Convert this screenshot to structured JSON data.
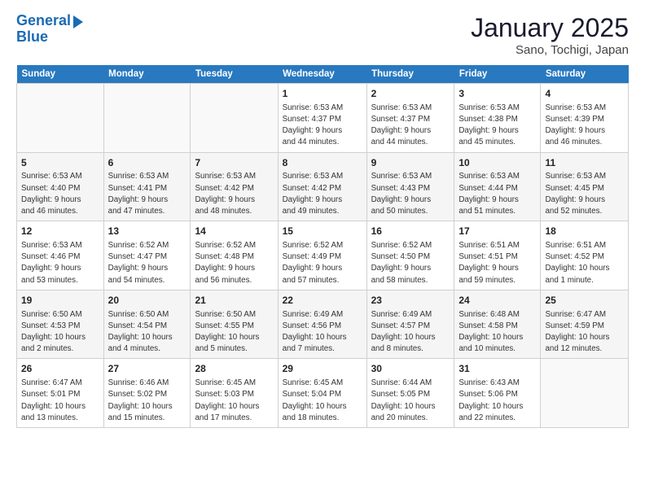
{
  "header": {
    "logo_line1": "General",
    "logo_line2": "Blue",
    "month": "January 2025",
    "location": "Sano, Tochigi, Japan"
  },
  "days_of_week": [
    "Sunday",
    "Monday",
    "Tuesday",
    "Wednesday",
    "Thursday",
    "Friday",
    "Saturday"
  ],
  "weeks": [
    {
      "days": [
        {
          "num": "",
          "info": ""
        },
        {
          "num": "",
          "info": ""
        },
        {
          "num": "",
          "info": ""
        },
        {
          "num": "1",
          "info": "Sunrise: 6:53 AM\nSunset: 4:37 PM\nDaylight: 9 hours\nand 44 minutes."
        },
        {
          "num": "2",
          "info": "Sunrise: 6:53 AM\nSunset: 4:37 PM\nDaylight: 9 hours\nand 44 minutes."
        },
        {
          "num": "3",
          "info": "Sunrise: 6:53 AM\nSunset: 4:38 PM\nDaylight: 9 hours\nand 45 minutes."
        },
        {
          "num": "4",
          "info": "Sunrise: 6:53 AM\nSunset: 4:39 PM\nDaylight: 9 hours\nand 46 minutes."
        }
      ]
    },
    {
      "days": [
        {
          "num": "5",
          "info": "Sunrise: 6:53 AM\nSunset: 4:40 PM\nDaylight: 9 hours\nand 46 minutes."
        },
        {
          "num": "6",
          "info": "Sunrise: 6:53 AM\nSunset: 4:41 PM\nDaylight: 9 hours\nand 47 minutes."
        },
        {
          "num": "7",
          "info": "Sunrise: 6:53 AM\nSunset: 4:42 PM\nDaylight: 9 hours\nand 48 minutes."
        },
        {
          "num": "8",
          "info": "Sunrise: 6:53 AM\nSunset: 4:42 PM\nDaylight: 9 hours\nand 49 minutes."
        },
        {
          "num": "9",
          "info": "Sunrise: 6:53 AM\nSunset: 4:43 PM\nDaylight: 9 hours\nand 50 minutes."
        },
        {
          "num": "10",
          "info": "Sunrise: 6:53 AM\nSunset: 4:44 PM\nDaylight: 9 hours\nand 51 minutes."
        },
        {
          "num": "11",
          "info": "Sunrise: 6:53 AM\nSunset: 4:45 PM\nDaylight: 9 hours\nand 52 minutes."
        }
      ]
    },
    {
      "days": [
        {
          "num": "12",
          "info": "Sunrise: 6:53 AM\nSunset: 4:46 PM\nDaylight: 9 hours\nand 53 minutes."
        },
        {
          "num": "13",
          "info": "Sunrise: 6:52 AM\nSunset: 4:47 PM\nDaylight: 9 hours\nand 54 minutes."
        },
        {
          "num": "14",
          "info": "Sunrise: 6:52 AM\nSunset: 4:48 PM\nDaylight: 9 hours\nand 56 minutes."
        },
        {
          "num": "15",
          "info": "Sunrise: 6:52 AM\nSunset: 4:49 PM\nDaylight: 9 hours\nand 57 minutes."
        },
        {
          "num": "16",
          "info": "Sunrise: 6:52 AM\nSunset: 4:50 PM\nDaylight: 9 hours\nand 58 minutes."
        },
        {
          "num": "17",
          "info": "Sunrise: 6:51 AM\nSunset: 4:51 PM\nDaylight: 9 hours\nand 59 minutes."
        },
        {
          "num": "18",
          "info": "Sunrise: 6:51 AM\nSunset: 4:52 PM\nDaylight: 10 hours\nand 1 minute."
        }
      ]
    },
    {
      "days": [
        {
          "num": "19",
          "info": "Sunrise: 6:50 AM\nSunset: 4:53 PM\nDaylight: 10 hours\nand 2 minutes."
        },
        {
          "num": "20",
          "info": "Sunrise: 6:50 AM\nSunset: 4:54 PM\nDaylight: 10 hours\nand 4 minutes."
        },
        {
          "num": "21",
          "info": "Sunrise: 6:50 AM\nSunset: 4:55 PM\nDaylight: 10 hours\nand 5 minutes."
        },
        {
          "num": "22",
          "info": "Sunrise: 6:49 AM\nSunset: 4:56 PM\nDaylight: 10 hours\nand 7 minutes."
        },
        {
          "num": "23",
          "info": "Sunrise: 6:49 AM\nSunset: 4:57 PM\nDaylight: 10 hours\nand 8 minutes."
        },
        {
          "num": "24",
          "info": "Sunrise: 6:48 AM\nSunset: 4:58 PM\nDaylight: 10 hours\nand 10 minutes."
        },
        {
          "num": "25",
          "info": "Sunrise: 6:47 AM\nSunset: 4:59 PM\nDaylight: 10 hours\nand 12 minutes."
        }
      ]
    },
    {
      "days": [
        {
          "num": "26",
          "info": "Sunrise: 6:47 AM\nSunset: 5:01 PM\nDaylight: 10 hours\nand 13 minutes."
        },
        {
          "num": "27",
          "info": "Sunrise: 6:46 AM\nSunset: 5:02 PM\nDaylight: 10 hours\nand 15 minutes."
        },
        {
          "num": "28",
          "info": "Sunrise: 6:45 AM\nSunset: 5:03 PM\nDaylight: 10 hours\nand 17 minutes."
        },
        {
          "num": "29",
          "info": "Sunrise: 6:45 AM\nSunset: 5:04 PM\nDaylight: 10 hours\nand 18 minutes."
        },
        {
          "num": "30",
          "info": "Sunrise: 6:44 AM\nSunset: 5:05 PM\nDaylight: 10 hours\nand 20 minutes."
        },
        {
          "num": "31",
          "info": "Sunrise: 6:43 AM\nSunset: 5:06 PM\nDaylight: 10 hours\nand 22 minutes."
        },
        {
          "num": "",
          "info": ""
        }
      ]
    }
  ]
}
